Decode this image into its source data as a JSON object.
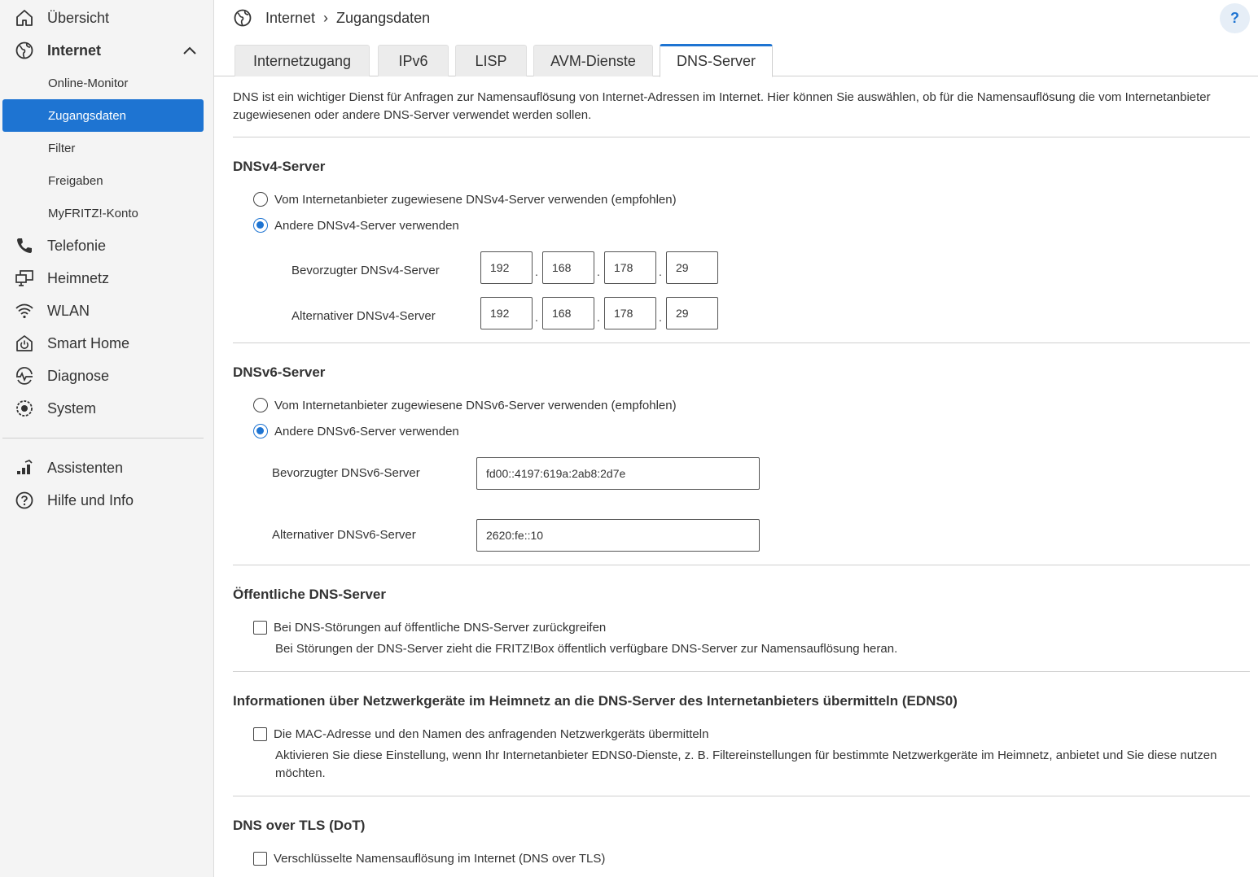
{
  "sidebar": {
    "items": [
      {
        "label": "Übersicht",
        "icon": "home-icon"
      },
      {
        "label": "Internet",
        "icon": "globe-icon"
      },
      {
        "label": "Telefonie",
        "icon": "phone-icon"
      },
      {
        "label": "Heimnetz",
        "icon": "home-network-icon"
      },
      {
        "label": "WLAN",
        "icon": "wifi-icon"
      },
      {
        "label": "Smart Home",
        "icon": "smart-home-icon"
      },
      {
        "label": "Diagnose",
        "icon": "diagnose-icon"
      },
      {
        "label": "System",
        "icon": "system-icon"
      },
      {
        "label": "Assistenten",
        "icon": "wizard-icon"
      },
      {
        "label": "Hilfe und Info",
        "icon": "help-circle-icon"
      }
    ],
    "internet_sub": [
      "Online-Monitor",
      "Zugangsdaten",
      "Filter",
      "Freigaben",
      "MyFRITZ!-Konto"
    ],
    "active_sub": "Zugangsdaten",
    "accent": "#1e74d2"
  },
  "header": {
    "crumbs": [
      "Internet",
      "Zugangsdaten"
    ],
    "separator": "›",
    "help": "?"
  },
  "tabs": [
    "Internetzugang",
    "IPv6",
    "LISP",
    "AVM-Dienste",
    "DNS-Server"
  ],
  "active_tab": "DNS-Server",
  "intro": "DNS ist ein wichtiger Dienst für Anfragen zur Namensauflösung von Internet-Adressen im Internet. Hier können Sie auswählen, ob für die Namensauflösung die vom Internetanbieter zugewiesenen oder andere DNS-Server verwendet werden sollen.",
  "dnsv4": {
    "title": "DNSv4-Server",
    "option_provider": "Vom Internetanbieter zugewiesene DNSv4-Server verwenden (empfohlen)",
    "option_other": "Andere DNSv4-Server verwenden",
    "selected": "other",
    "preferred_label": "Bevorzugter DNSv4-Server",
    "preferred": [
      "192",
      "168",
      "178",
      "29"
    ],
    "alternative_label": "Alternativer DNSv4-Server",
    "alternative": [
      "192",
      "168",
      "178",
      "29"
    ],
    "dot": "."
  },
  "dnsv6": {
    "title": "DNSv6-Server",
    "option_provider": "Vom Internetanbieter zugewiesene DNSv6-Server verwenden (empfohlen)",
    "option_other": "Andere DNSv6-Server verwenden",
    "selected": "other",
    "preferred_label": "Bevorzugter DNSv6-Server",
    "preferred": "fd00::4197:619a:2ab8:2d7e",
    "alternative_label": "Alternativer DNSv6-Server",
    "alternative": "2620:fe::10"
  },
  "public_dns": {
    "title": "Öffentliche DNS-Server",
    "checkbox": "Bei DNS-Störungen auf öffentliche DNS-Server zurückgreifen",
    "checked": false,
    "hint": "Bei Störungen der DNS-Server zieht die FRITZ!Box öffentlich verfügbare DNS-Server zur Namensauflösung heran."
  },
  "edns0": {
    "title": "Informationen über Netzwerkgeräte im Heimnetz an die DNS-Server des Internetanbieters übermitteln (EDNS0)",
    "checkbox": "Die MAC-Adresse und den Namen des anfragenden Netzwerkgeräts übermitteln",
    "checked": false,
    "hint": "Aktivieren Sie diese Einstellung, wenn Ihr Internetanbieter EDNS0-Dienste, z. B. Filtereinstellungen für bestimmte Netzwerkgeräte im Heimnetz, anbietet und Sie diese nutzen möchten."
  },
  "dot": {
    "title": "DNS over TLS (DoT)",
    "checkbox": "Verschlüsselte Namensauflösung im Internet (DNS over TLS)",
    "checked": false
  }
}
